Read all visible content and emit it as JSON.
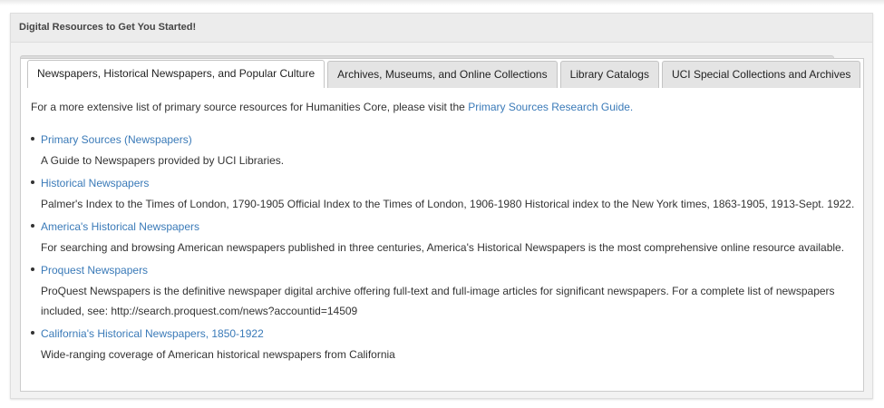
{
  "box": {
    "title": "Digital Resources to Get You Started!"
  },
  "tabs": [
    {
      "label": "Newspapers, Historical Newspapers, and Popular Culture",
      "active": true
    },
    {
      "label": "Archives, Museums, and Online Collections",
      "active": false
    },
    {
      "label": "Library Catalogs",
      "active": false
    },
    {
      "label": "UCI Special Collections and Archives",
      "active": false
    }
  ],
  "intro": {
    "text": "For a more extensive list of primary source resources for Humanities Core, please visit the ",
    "link_text": "Primary Sources Research Guide."
  },
  "resources": [
    {
      "title": "Primary Sources (Newspapers)",
      "description": "A Guide to Newspapers provided by UCI Libraries."
    },
    {
      "title": "Historical Newspapers",
      "description": "Palmer's Index to the Times of London, 1790-1905 Official Index to the Times of London, 1906-1980 Historical index to the New York times, 1863-1905, 1913-Sept. 1922."
    },
    {
      "title": "America's Historical Newspapers",
      "description": "For searching and browsing American newspapers published in three centuries, America's Historical Newspapers is the most comprehensive online resource available."
    },
    {
      "title": "Proquest Newspapers",
      "description": "ProQuest Newspapers is the definitive newspaper digital archive offering full-text and full-image articles for significant newspapers. For a complete list of newspapers included, see: http://search.proquest.com/news?accountid=14509"
    },
    {
      "title": "California's Historical Newspapers, 1850-1922",
      "description": "Wide-ranging coverage of American historical newspapers from California"
    }
  ],
  "colors": {
    "link": "#3a7ab8",
    "text": "#333333",
    "panel_bg": "#f2f2f2"
  }
}
